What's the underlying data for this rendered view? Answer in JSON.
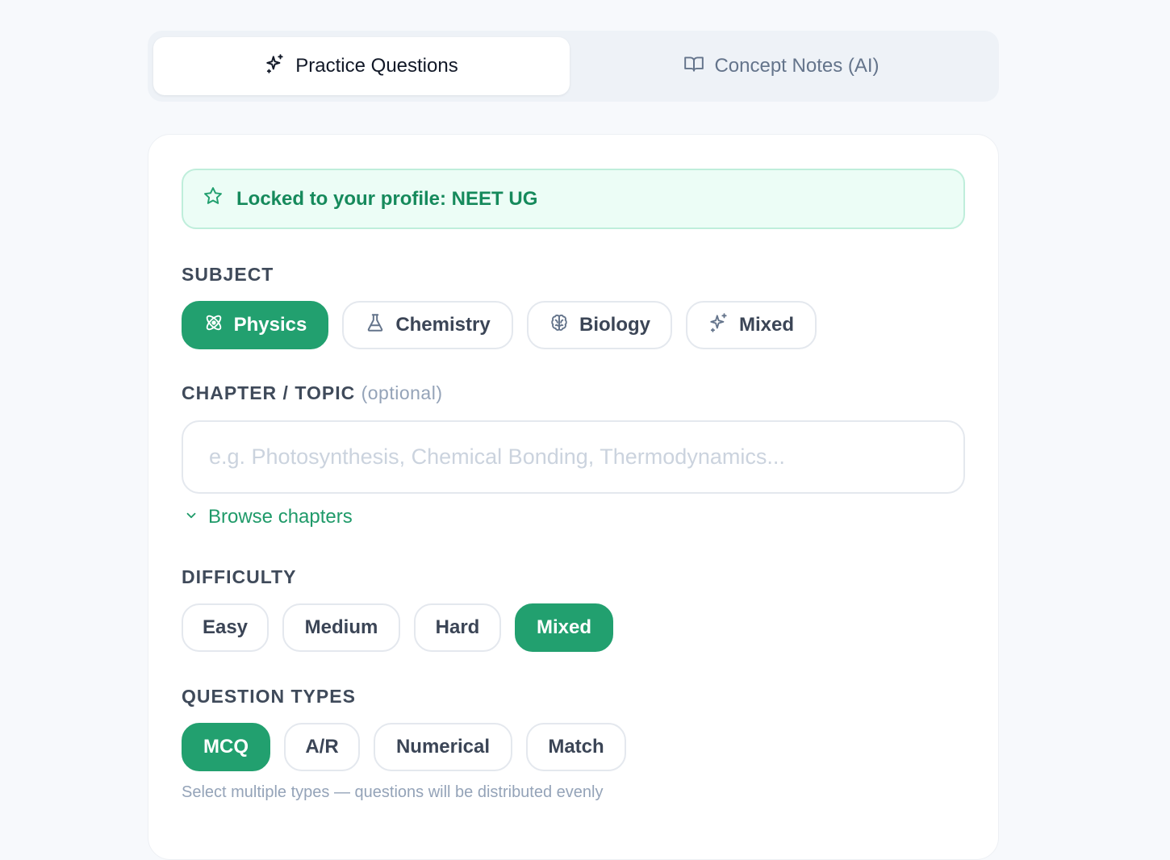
{
  "tabs": [
    {
      "label": "Practice Questions",
      "icon": "sparkles-icon",
      "active": true
    },
    {
      "label": "Concept Notes (AI)",
      "icon": "book-open-icon",
      "active": false
    }
  ],
  "banner": {
    "text": "Locked to your profile: NEET UG",
    "icon": "star-icon"
  },
  "subject": {
    "label": "SUBJECT",
    "options": [
      {
        "label": "Physics",
        "icon": "atom-icon",
        "selected": true
      },
      {
        "label": "Chemistry",
        "icon": "flask-icon",
        "selected": false
      },
      {
        "label": "Biology",
        "icon": "brain-icon",
        "selected": false
      },
      {
        "label": "Mixed",
        "icon": "sparkles-icon",
        "selected": false
      }
    ]
  },
  "chapter": {
    "label": "CHAPTER / TOPIC",
    "optional": "(optional)",
    "placeholder": "e.g. Photosynthesis, Chemical Bonding, Thermodynamics...",
    "value": "",
    "browse_label": "Browse chapters"
  },
  "difficulty": {
    "label": "DIFFICULTY",
    "options": [
      {
        "label": "Easy",
        "selected": false
      },
      {
        "label": "Medium",
        "selected": false
      },
      {
        "label": "Hard",
        "selected": false
      },
      {
        "label": "Mixed",
        "selected": true
      }
    ]
  },
  "question_types": {
    "label": "QUESTION TYPES",
    "options": [
      {
        "label": "MCQ",
        "selected": true
      },
      {
        "label": "A/R",
        "selected": false
      },
      {
        "label": "Numerical",
        "selected": false
      },
      {
        "label": "Match",
        "selected": false
      }
    ],
    "hint": "Select multiple types — questions will be distributed evenly"
  },
  "colors": {
    "accent": "#22a06f",
    "banner_bg": "#ecfdf6",
    "banner_text": "#168a5c"
  }
}
